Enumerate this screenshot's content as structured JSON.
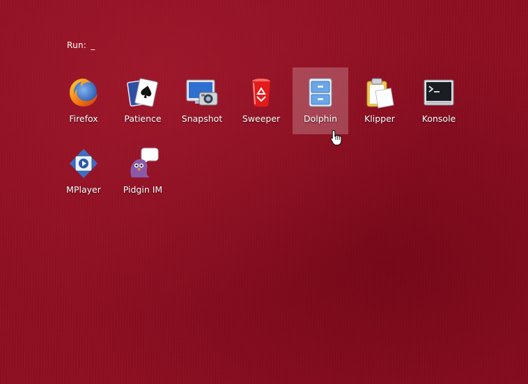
{
  "run_prompt": {
    "label": "Run:",
    "cursor": "_"
  },
  "launchers": [
    {
      "label": "Firefox",
      "icon": "firefox-icon",
      "selected": false
    },
    {
      "label": "Patience",
      "icon": "playing-cards-icon",
      "selected": false
    },
    {
      "label": "Snapshot",
      "icon": "camera-monitor-icon",
      "selected": false
    },
    {
      "label": "Sweeper",
      "icon": "recycle-bin-icon",
      "selected": false
    },
    {
      "label": "Dolphin",
      "icon": "file-cabinet-icon",
      "selected": true
    },
    {
      "label": "Klipper",
      "icon": "clipboard-icon",
      "selected": false
    },
    {
      "label": "Konsole",
      "icon": "terminal-icon",
      "selected": false
    },
    {
      "label": "MPlayer",
      "icon": "media-player-icon",
      "selected": false
    },
    {
      "label": "Pidgin IM",
      "icon": "pidgin-bird-icon",
      "selected": false
    }
  ],
  "colors": {
    "background": "#8f0f22",
    "text": "#ffffff",
    "selection": "rgba(255,255,255,0.22)"
  }
}
